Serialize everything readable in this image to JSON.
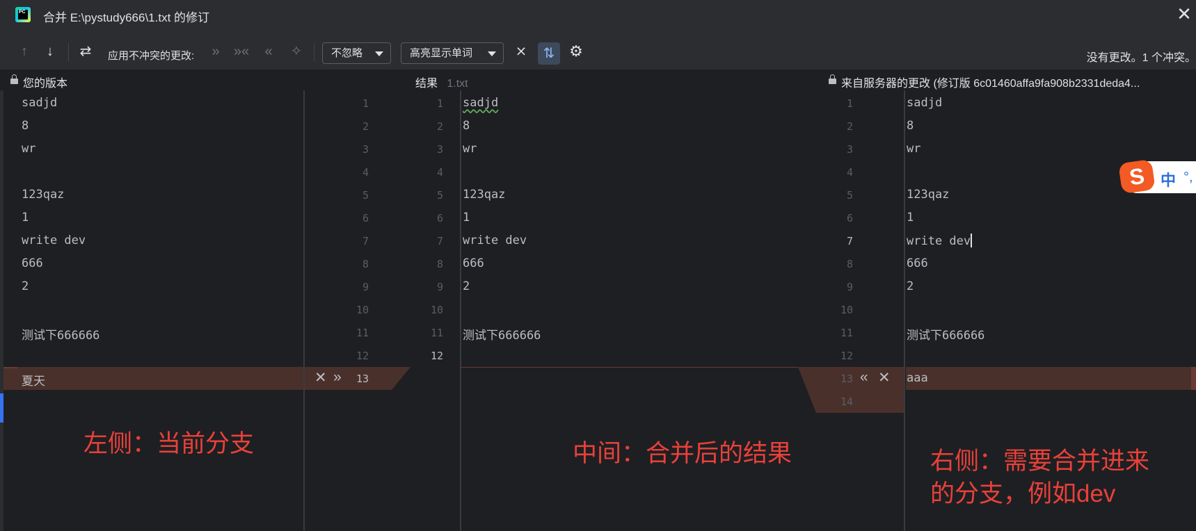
{
  "window": {
    "title": "合并 E:\\pystudy666\\1.txt 的修订",
    "app_icon_text": "PC"
  },
  "toolbar": {
    "prev_change_icon": "↑",
    "next_change_icon": "↓",
    "apply_label": "应用不冲突的更改:",
    "ignore_dropdown": "不忽略",
    "highlight_dropdown": "高亮显示单词",
    "status": "没有更改。1 个冲突。"
  },
  "headers": {
    "yours": "您的版本",
    "result": "结果",
    "result_file": "1.txt",
    "theirs": "来自服务器的更改 (修订版 6c01460affa9fa908b2331deda4..."
  },
  "left_panel": {
    "lines": [
      "sadjd",
      "8",
      "wr",
      "",
      "123qaz",
      "1",
      "write dev",
      "666",
      "2",
      "",
      "测试下666666",
      "",
      "夏天"
    ]
  },
  "result_panel": {
    "left_gutter_numbers": [
      "1",
      "2",
      "3",
      "4",
      "5",
      "6",
      "7",
      "8",
      "9",
      "10",
      "11",
      "12",
      "13"
    ],
    "line_numbers": [
      "1",
      "2",
      "3",
      "4",
      "5",
      "6",
      "7",
      "8",
      "9",
      "10",
      "11",
      "12"
    ],
    "active_line_number": "12",
    "lines": [
      "sadjd",
      "8",
      "wr",
      "",
      "123qaz",
      "1",
      "write dev",
      "666",
      "2",
      "",
      "测试下666666",
      ""
    ],
    "right_gutter_numbers": [
      "1",
      "2",
      "3",
      "4",
      "5",
      "6",
      "7",
      "8",
      "9",
      "10",
      "11",
      "12",
      "13",
      "14"
    ],
    "active_right_number": "7"
  },
  "right_panel": {
    "lines": [
      "sadjd",
      "8",
      "wr",
      "",
      "123qaz",
      "1",
      "write dev",
      "666",
      "2",
      "",
      "测试下666666",
      "",
      "aaa"
    ]
  },
  "annotations": {
    "left": "左侧：当前分支",
    "middle": "中间：合并后的结果",
    "right_line1": "右侧：需要合并进来",
    "right_line2": "的分支，例如dev"
  },
  "ime": {
    "label": "中"
  },
  "colors": {
    "background": "#1e1f22",
    "conflict": "#4a302b",
    "annotation": "#e8413a",
    "accent": "#3574f0"
  }
}
